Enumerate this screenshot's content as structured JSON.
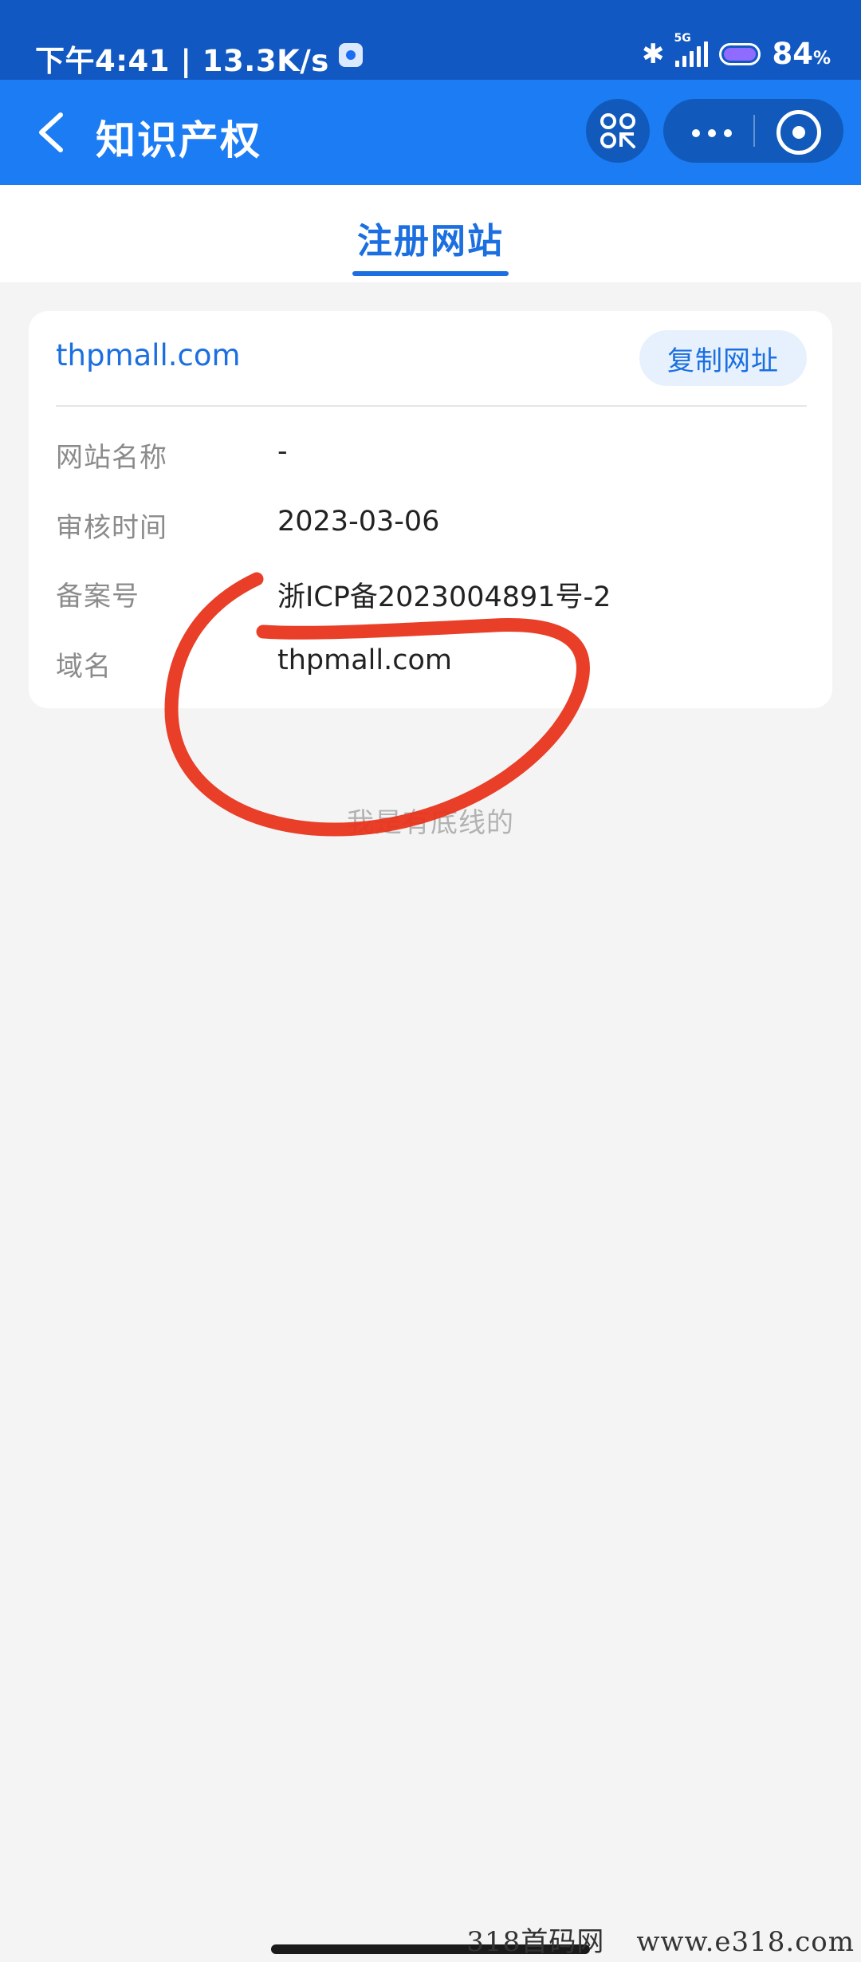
{
  "status_bar": {
    "time_speed": "下午4:41 | 13.3K/s",
    "network_label": "5G",
    "battery_percent": "84",
    "battery_unit": "%"
  },
  "nav": {
    "title": "知识产权"
  },
  "tab": {
    "label": "注册网站"
  },
  "card": {
    "domain": "thpmall.com",
    "copy_button": "复制网址",
    "rows": [
      {
        "label": "网站名称",
        "value": "-"
      },
      {
        "label": "审核时间",
        "value": "2023-03-06"
      },
      {
        "label": "备案号",
        "value": "浙ICP备2023004891号-2"
      },
      {
        "label": "域名",
        "value": "thpmall.com"
      }
    ]
  },
  "footer": {
    "text": "我是有底线的"
  },
  "watermark": {
    "site_name": "318首码网",
    "url": "www.e318.com"
  },
  "colors": {
    "nav_blue": "#1b7cf4",
    "status_blue": "#1158c2",
    "accent_blue": "#1b6fe0",
    "annotation_red": "#e8341c"
  }
}
